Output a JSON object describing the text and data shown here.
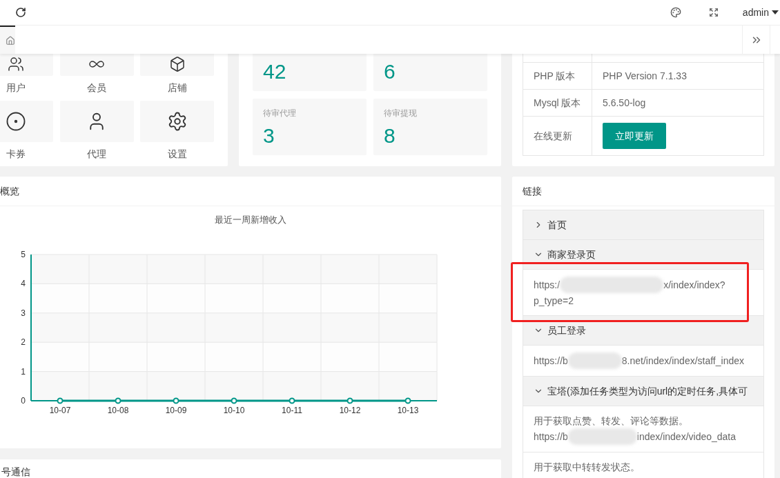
{
  "topbar": {
    "user": "admin"
  },
  "shortcuts": [
    {
      "label": "用户"
    },
    {
      "label": "会员"
    },
    {
      "label": "店铺"
    },
    {
      "label": "卡券"
    },
    {
      "label": "代理"
    },
    {
      "label": "设置"
    }
  ],
  "stats": [
    {
      "value": "42"
    },
    {
      "value": "6"
    },
    {
      "label": "待审代理",
      "value": "3"
    },
    {
      "label": "待审提现",
      "value": "8"
    }
  ],
  "info": [
    {
      "kind": "blank"
    },
    {
      "kind": "text",
      "label": "PHP 版本",
      "value": "PHP Version 7.1.33"
    },
    {
      "kind": "text",
      "label": "Mysql 版本",
      "value": "5.6.50-log"
    },
    {
      "kind": "button",
      "label": "在线更新",
      "value": "立即更新"
    }
  ],
  "overview": {
    "title": "概览",
    "chart_data": {
      "type": "line",
      "title": "最近一周新增收入",
      "categories": [
        "10-07",
        "10-08",
        "10-09",
        "10-10",
        "10-11",
        "10-12",
        "10-13"
      ],
      "series": [
        {
          "color": "#009688",
          "marker": "circle",
          "values": [
            0,
            0,
            0,
            0,
            0,
            0,
            0
          ]
        }
      ],
      "grid": true,
      "ylim": [
        0,
        5
      ],
      "yticks": [
        0,
        1,
        2,
        3,
        4,
        5
      ]
    }
  },
  "next_card": {
    "title": "号通信"
  },
  "links": {
    "title": "链接",
    "items": [
      {
        "title": "首页",
        "expanded": false
      },
      {
        "title": "商家登录页",
        "expanded": true,
        "blocks": [
          [
            {
              "kind": "url",
              "prefix": "https:/",
              "suffix": "x/index/index?",
              "continued": "p_type=2"
            }
          ]
        ]
      },
      {
        "title": "员工登录",
        "expanded": true,
        "blocks": [
          [
            {
              "kind": "url",
              "prefix": "https://b",
              "suffix": "8.net/index/index/staff_index"
            }
          ]
        ]
      },
      {
        "title": "宝塔(添加任务类型为访问url的定时任务,具体可",
        "expanded": true,
        "blocks": [
          [
            {
              "kind": "note",
              "text": "用于获取点赞、转发、评论等数据。"
            },
            {
              "kind": "url",
              "prefix": "https://b",
              "suffix": "index/index/video_data"
            }
          ],
          [
            {
              "kind": "note",
              "text": "用于获取中转转发状态。"
            }
          ]
        ]
      }
    ]
  }
}
